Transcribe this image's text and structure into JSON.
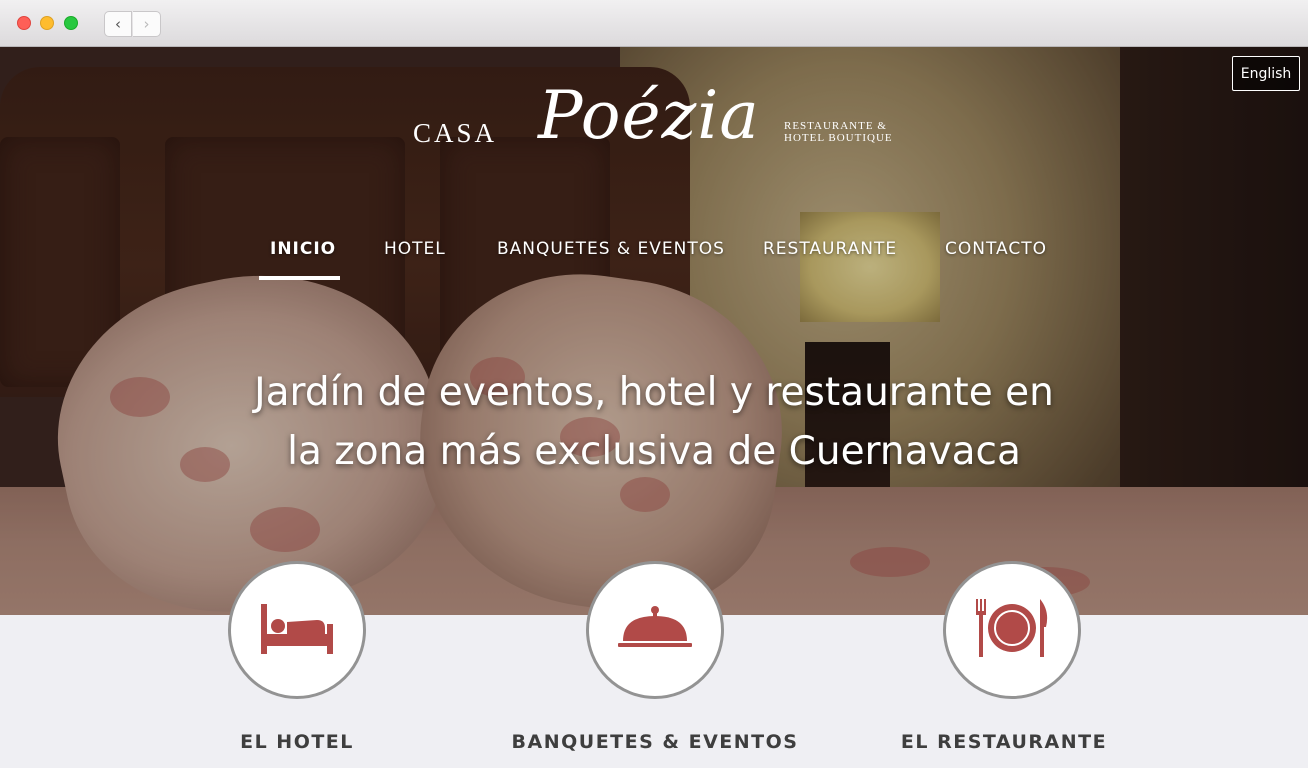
{
  "browser": {
    "back_icon": "chevron-left-icon",
    "forward_icon": "chevron-right-icon"
  },
  "header": {
    "language_button": "English",
    "logo": {
      "casa": "CASA",
      "poezia": "Poézia",
      "subtitle_line1": "RESTAURANTE &",
      "subtitle_line2": "HOTEL BOUTIQUE"
    }
  },
  "nav": {
    "items": [
      {
        "label": "INICIO",
        "active": true
      },
      {
        "label": "HOTEL",
        "active": false
      },
      {
        "label": "BANQUETES & EVENTOS",
        "active": false
      },
      {
        "label": "RESTAURANTE",
        "active": false
      },
      {
        "label": "CONTACTO",
        "active": false
      }
    ]
  },
  "hero": {
    "headline_line1": "Jardín de eventos, hotel y restaurante en",
    "headline_line2": "la zona más exclusiva de Cuernavaca"
  },
  "features": [
    {
      "label": "EL HOTEL",
      "icon": "bed-icon"
    },
    {
      "label": "BANQUETES & EVENTOS",
      "icon": "cloche-icon"
    },
    {
      "label": "EL RESTAURANTE",
      "icon": "plate-cutlery-icon"
    }
  ],
  "colors": {
    "accent": "#b14a48",
    "circle_border": "#939393",
    "bottom_bg": "#efeff3",
    "label_text": "#3e3e3e"
  }
}
